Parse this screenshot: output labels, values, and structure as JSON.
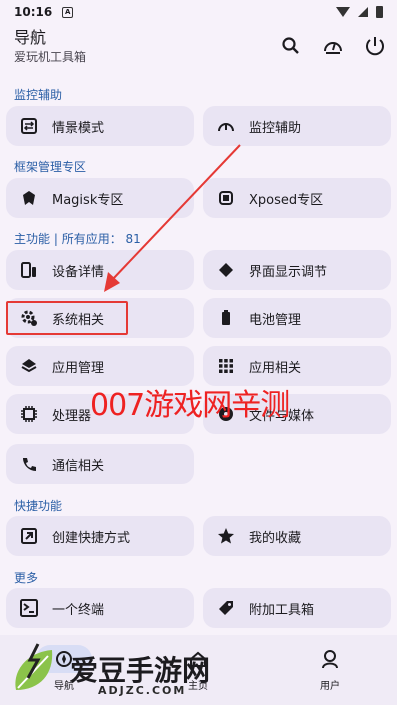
{
  "status": {
    "time": "10:16",
    "notif": "A"
  },
  "appbar": {
    "title": "导航",
    "subtitle": "爱玩机工具箱"
  },
  "sections": {
    "monitor": "监控辅助",
    "framework": "框架管理专区",
    "main_label": "主功能",
    "apps_label": "所有应用",
    "apps_count": "81",
    "quick": "快捷功能",
    "more": "更多"
  },
  "items": {
    "scene": "情景模式",
    "monitor_assist": "监控辅助",
    "magisk": "Magisk专区",
    "xposed": "Xposed专区",
    "device": "设备详情",
    "display": "界面显示调节",
    "system": "系统相关",
    "battery": "电池管理",
    "appmgr": "应用管理",
    "apprel": "应用相关",
    "cpu": "处理器",
    "files": "文件与媒体",
    "comm": "通信相关",
    "shortcut": "创建快捷方式",
    "fav": "我的收藏",
    "terminal": "一个终端",
    "toolbox": "附加工具箱"
  },
  "overlay": {
    "watermark": "007游戏网辛测",
    "logo_text": "爱豆手游网",
    "logo_url": "ADJZC.COM"
  },
  "nav": {
    "nav": "导航",
    "home": "主页",
    "user": "用户"
  },
  "colors": {
    "accent": "#2b5fa6",
    "card": "#e9e4f3",
    "highlight": "#e53935"
  }
}
